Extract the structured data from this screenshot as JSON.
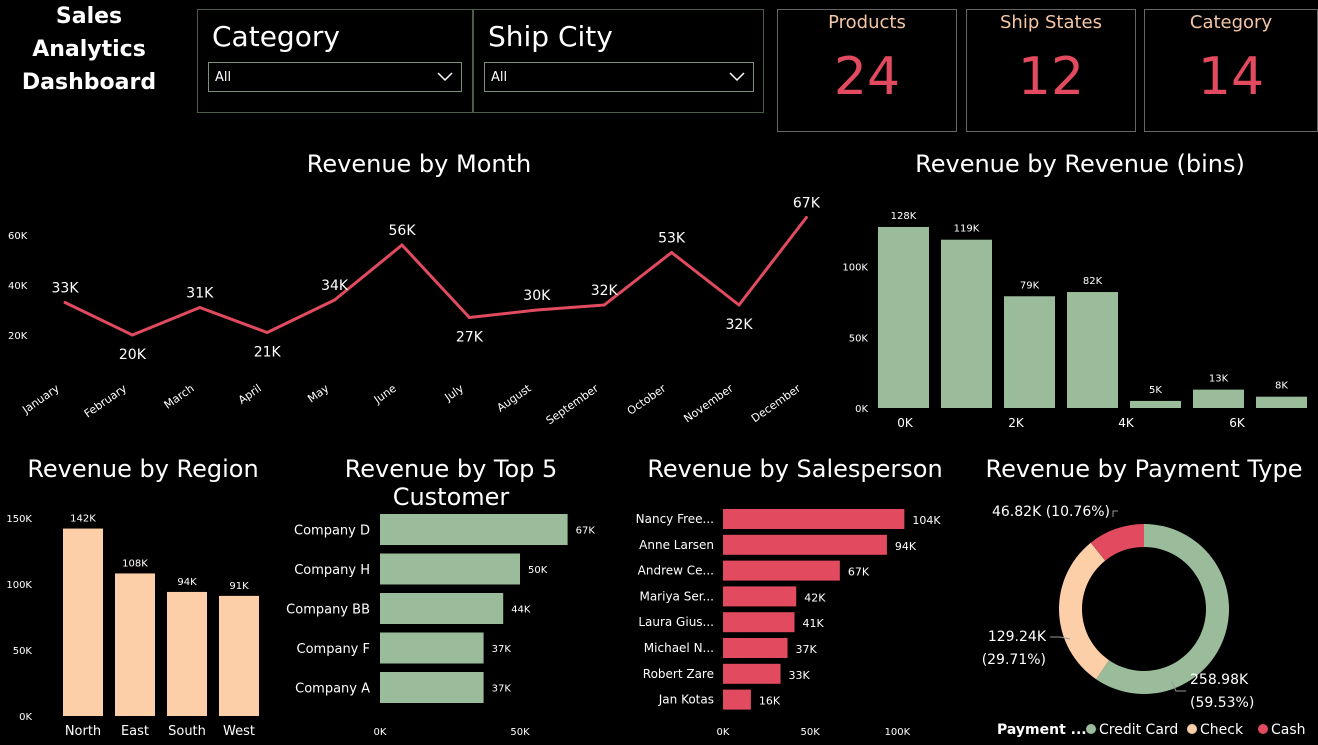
{
  "header": {
    "title_line1": "Sales Analytics",
    "title_line2": "Dashboard"
  },
  "slicers": [
    {
      "label": "Category",
      "value": "All"
    },
    {
      "label": "Ship City",
      "value": "All"
    }
  ],
  "cards": [
    {
      "title": "Products",
      "value": "24"
    },
    {
      "title": "Ship States",
      "value": "12"
    },
    {
      "title": "Category",
      "value": "14"
    }
  ],
  "colors": {
    "accent_red": "#e24a5f",
    "green": "#9bbc9b",
    "peach": "#fdcfa8",
    "card_title": "#f4c6a6"
  },
  "chart_data": [
    {
      "type": "line",
      "title": "Revenue by Month",
      "categories": [
        "January",
        "February",
        "March",
        "April",
        "May",
        "June",
        "July",
        "August",
        "September",
        "October",
        "November",
        "December"
      ],
      "values": [
        33,
        20,
        31,
        21,
        34,
        56,
        27,
        30,
        32,
        53,
        32,
        67
      ],
      "labels": [
        "33K",
        "20K",
        "31K",
        "21K",
        "34K",
        "56K",
        "27K",
        "30K",
        "32K",
        "53K",
        "32K",
        "67K"
      ],
      "unit": "K",
      "y_ticks": [
        "20K",
        "40K",
        "60K"
      ],
      "ylim": [
        12,
        70
      ],
      "color": "#e24a5f"
    },
    {
      "type": "bar",
      "title": "Revenue by Revenue (bins)",
      "values": [
        128,
        119,
        79,
        82,
        5,
        13,
        8
      ],
      "labels": [
        "128K",
        "119K",
        "79K",
        "82K",
        "5K",
        "13K",
        "8K"
      ],
      "x_ticks": [
        "0K",
        "2K",
        "4K",
        "6K"
      ],
      "y_ticks": [
        "0K",
        "50K",
        "100K"
      ],
      "ylim": [
        0,
        140
      ],
      "color": "#9bbc9b"
    },
    {
      "type": "bar",
      "title": "Revenue by Region",
      "categories": [
        "North",
        "East",
        "South",
        "West"
      ],
      "values": [
        142,
        108,
        94,
        91
      ],
      "labels": [
        "142K",
        "108K",
        "94K",
        "91K"
      ],
      "y_ticks": [
        "0K",
        "50K",
        "100K",
        "150K"
      ],
      "ylim": [
        0,
        150
      ],
      "color": "#fdcfa8"
    },
    {
      "type": "bar",
      "orientation": "horizontal",
      "title": "Revenue by Top 5 Customer",
      "categories": [
        "Company D",
        "Company H",
        "Company BB",
        "Company F",
        "Company A"
      ],
      "values": [
        67,
        50,
        44,
        37,
        37
      ],
      "labels": [
        "67K",
        "50K",
        "44K",
        "37K",
        "37K"
      ],
      "x_ticks": [
        "0K",
        "50K"
      ],
      "xlim": [
        0,
        80
      ],
      "color": "#9bbc9b"
    },
    {
      "type": "bar",
      "orientation": "horizontal",
      "title": "Revenue by Salesperson",
      "categories": [
        "Nancy Free...",
        "Anne Larsen",
        "Andrew Ce...",
        "Mariya Ser...",
        "Laura Gius...",
        "Michael N...",
        "Robert Zare",
        "Jan Kotas"
      ],
      "values": [
        104,
        94,
        67,
        42,
        41,
        37,
        33,
        16
      ],
      "labels": [
        "104K",
        "94K",
        "67K",
        "42K",
        "41K",
        "37K",
        "33K",
        "16K"
      ],
      "x_ticks": [
        "0K",
        "50K",
        "100K"
      ],
      "xlim": [
        0,
        125
      ],
      "color": "#e24a5f"
    },
    {
      "type": "pie",
      "title": "Revenue by Payment Type",
      "legend_title": "Payment ...",
      "slices": [
        {
          "name": "Credit Card",
          "value": 258.98,
          "label1": "258.98K",
          "label2": "(59.53%)",
          "color": "#9bbc9b"
        },
        {
          "name": "Check",
          "value": 129.24,
          "label1": "129.24K",
          "label2": "(29.71%)",
          "color": "#fdcfa8"
        },
        {
          "name": "Cash",
          "value": 46.82,
          "label1": "46.82K (10.76%)",
          "label2": "",
          "color": "#e24a5f"
        }
      ]
    }
  ]
}
